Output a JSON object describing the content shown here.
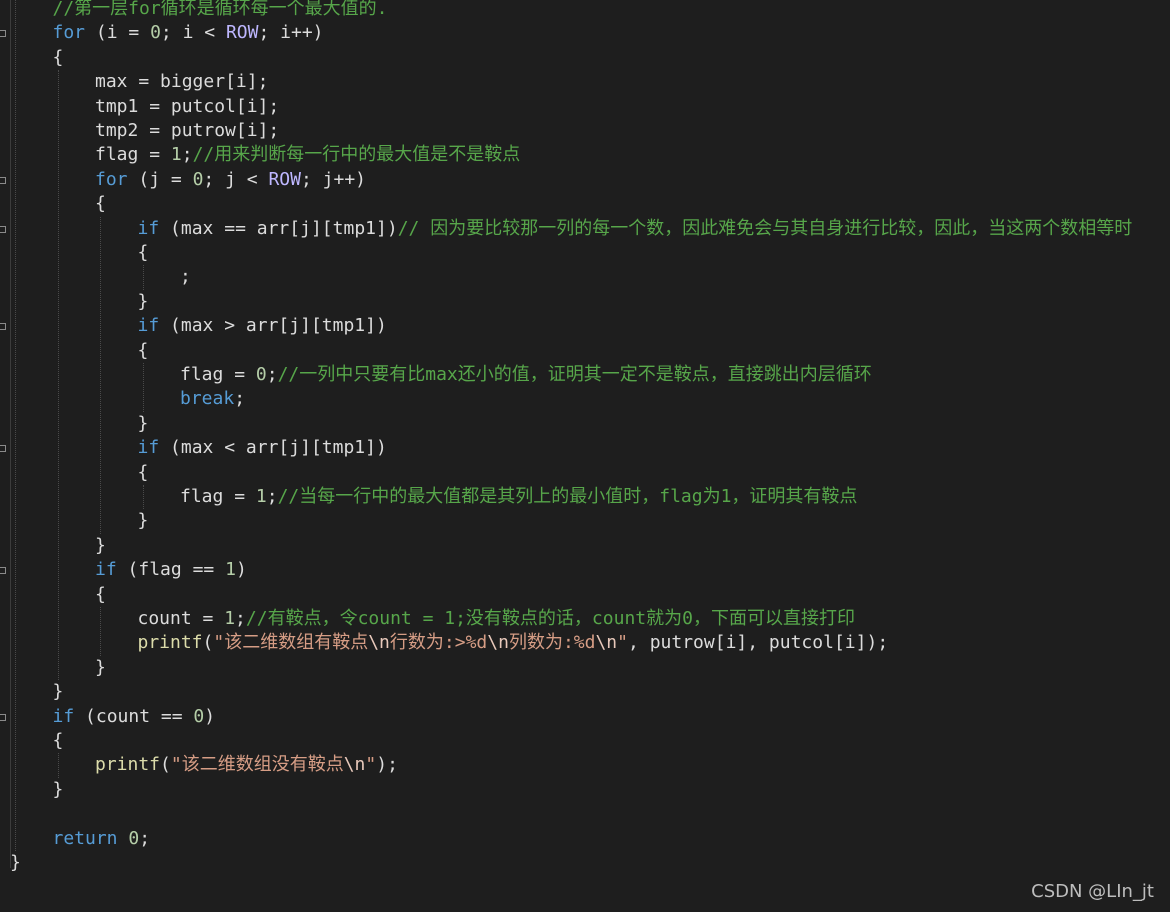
{
  "editor": {
    "watermark": "CSDN @LIn_jt",
    "colors": {
      "background": "#1e1e1e",
      "keyword": "#569cd6",
      "number": "#b5cea8",
      "comment": "#57a64a",
      "string": "#d69d85",
      "function": "#dcdcaa",
      "macro": "#beb7ff",
      "text": "#dcdcdc"
    },
    "lines": [
      {
        "indent": 1,
        "tokens": [
          [
            "cmt",
            "//第一层for循环是循环每一个最大值的."
          ]
        ]
      },
      {
        "indent": 1,
        "tokens": [
          [
            "kw",
            "for"
          ],
          [
            "pun",
            " ("
          ],
          [
            "var",
            "i"
          ],
          [
            "pun",
            " = "
          ],
          [
            "num",
            "0"
          ],
          [
            "pun",
            "; "
          ],
          [
            "var",
            "i"
          ],
          [
            "pun",
            " < "
          ],
          [
            "mac",
            "ROW"
          ],
          [
            "pun",
            "; "
          ],
          [
            "var",
            "i"
          ],
          [
            "pun",
            "++)"
          ]
        ]
      },
      {
        "indent": 1,
        "tokens": [
          [
            "pun",
            "{"
          ]
        ]
      },
      {
        "indent": 2,
        "tokens": [
          [
            "var",
            "max"
          ],
          [
            "pun",
            " = "
          ],
          [
            "var",
            "bigger"
          ],
          [
            "pun",
            "["
          ],
          [
            "var",
            "i"
          ],
          [
            "pun",
            "];"
          ]
        ]
      },
      {
        "indent": 2,
        "tokens": [
          [
            "var",
            "tmp1"
          ],
          [
            "pun",
            " = "
          ],
          [
            "var",
            "putcol"
          ],
          [
            "pun",
            "["
          ],
          [
            "var",
            "i"
          ],
          [
            "pun",
            "];"
          ]
        ]
      },
      {
        "indent": 2,
        "tokens": [
          [
            "var",
            "tmp2"
          ],
          [
            "pun",
            " = "
          ],
          [
            "var",
            "putrow"
          ],
          [
            "pun",
            "["
          ],
          [
            "var",
            "i"
          ],
          [
            "pun",
            "];"
          ]
        ]
      },
      {
        "indent": 2,
        "tokens": [
          [
            "var",
            "flag"
          ],
          [
            "pun",
            " = "
          ],
          [
            "num",
            "1"
          ],
          [
            "pun",
            ";"
          ],
          [
            "cmt",
            "//用来判断每一行中的最大值是不是鞍点"
          ]
        ]
      },
      {
        "indent": 2,
        "tokens": [
          [
            "kw",
            "for"
          ],
          [
            "pun",
            " ("
          ],
          [
            "var",
            "j"
          ],
          [
            "pun",
            " = "
          ],
          [
            "num",
            "0"
          ],
          [
            "pun",
            "; "
          ],
          [
            "var",
            "j"
          ],
          [
            "pun",
            " < "
          ],
          [
            "mac",
            "ROW"
          ],
          [
            "pun",
            "; "
          ],
          [
            "var",
            "j"
          ],
          [
            "pun",
            "++)"
          ]
        ]
      },
      {
        "indent": 2,
        "tokens": [
          [
            "pun",
            "{"
          ]
        ]
      },
      {
        "indent": 3,
        "tokens": [
          [
            "kw",
            "if"
          ],
          [
            "pun",
            " ("
          ],
          [
            "var",
            "max"
          ],
          [
            "pun",
            " == "
          ],
          [
            "var",
            "arr"
          ],
          [
            "pun",
            "["
          ],
          [
            "var",
            "j"
          ],
          [
            "pun",
            "]["
          ],
          [
            "var",
            "tmp1"
          ],
          [
            "pun",
            "])"
          ],
          [
            "cmt",
            "// 因为要比较那一列的每一个数，因此难免会与其自身进行比较，因此，当这两个数相等时"
          ]
        ]
      },
      {
        "indent": 3,
        "tokens": [
          [
            "pun",
            "{"
          ]
        ]
      },
      {
        "indent": 4,
        "tokens": [
          [
            "pun",
            ";"
          ]
        ]
      },
      {
        "indent": 3,
        "tokens": [
          [
            "pun",
            "}"
          ]
        ]
      },
      {
        "indent": 3,
        "tokens": [
          [
            "kw",
            "if"
          ],
          [
            "pun",
            " ("
          ],
          [
            "var",
            "max"
          ],
          [
            "pun",
            " > "
          ],
          [
            "var",
            "arr"
          ],
          [
            "pun",
            "["
          ],
          [
            "var",
            "j"
          ],
          [
            "pun",
            "]["
          ],
          [
            "var",
            "tmp1"
          ],
          [
            "pun",
            "])"
          ]
        ]
      },
      {
        "indent": 3,
        "tokens": [
          [
            "pun",
            "{"
          ]
        ]
      },
      {
        "indent": 4,
        "tokens": [
          [
            "var",
            "flag"
          ],
          [
            "pun",
            " = "
          ],
          [
            "num",
            "0"
          ],
          [
            "pun",
            ";"
          ],
          [
            "cmt",
            "//一列中只要有比max还小的值，证明其一定不是鞍点，直接跳出内层循环"
          ]
        ]
      },
      {
        "indent": 4,
        "tokens": [
          [
            "kw",
            "break"
          ],
          [
            "pun",
            ";"
          ]
        ]
      },
      {
        "indent": 3,
        "tokens": [
          [
            "pun",
            "}"
          ]
        ]
      },
      {
        "indent": 3,
        "tokens": [
          [
            "kw",
            "if"
          ],
          [
            "pun",
            " ("
          ],
          [
            "var",
            "max"
          ],
          [
            "pun",
            " < "
          ],
          [
            "var",
            "arr"
          ],
          [
            "pun",
            "["
          ],
          [
            "var",
            "j"
          ],
          [
            "pun",
            "]["
          ],
          [
            "var",
            "tmp1"
          ],
          [
            "pun",
            "])"
          ]
        ]
      },
      {
        "indent": 3,
        "tokens": [
          [
            "pun",
            "{"
          ]
        ]
      },
      {
        "indent": 4,
        "tokens": [
          [
            "var",
            "flag"
          ],
          [
            "pun",
            " = "
          ],
          [
            "num",
            "1"
          ],
          [
            "pun",
            ";"
          ],
          [
            "cmt",
            "//当每一行中的最大值都是其列上的最小值时，flag为1，证明其有鞍点"
          ]
        ]
      },
      {
        "indent": 3,
        "tokens": [
          [
            "pun",
            "}"
          ]
        ]
      },
      {
        "indent": 2,
        "tokens": [
          [
            "pun",
            "}"
          ]
        ]
      },
      {
        "indent": 2,
        "tokens": [
          [
            "kw",
            "if"
          ],
          [
            "pun",
            " ("
          ],
          [
            "var",
            "flag"
          ],
          [
            "pun",
            " == "
          ],
          [
            "num",
            "1"
          ],
          [
            "pun",
            ")"
          ]
        ]
      },
      {
        "indent": 2,
        "tokens": [
          [
            "pun",
            "{"
          ]
        ]
      },
      {
        "indent": 3,
        "tokens": [
          [
            "var",
            "count"
          ],
          [
            "pun",
            " = "
          ],
          [
            "num",
            "1"
          ],
          [
            "pun",
            ";"
          ],
          [
            "cmt",
            "//有鞍点，令count = 1;没有鞍点的话，count就为0，下面可以直接打印"
          ]
        ]
      },
      {
        "indent": 3,
        "tokens": [
          [
            "fn",
            "printf"
          ],
          [
            "pun",
            "("
          ],
          [
            "str",
            "\"该二维数组有鞍点"
          ],
          [
            "esc",
            "\\n"
          ],
          [
            "str",
            "行数为:>%d"
          ],
          [
            "esc",
            "\\n"
          ],
          [
            "str",
            "列数为:%d"
          ],
          [
            "esc",
            "\\n"
          ],
          [
            "str",
            "\""
          ],
          [
            "pun",
            ", "
          ],
          [
            "var",
            "putrow"
          ],
          [
            "pun",
            "["
          ],
          [
            "var",
            "i"
          ],
          [
            "pun",
            "], "
          ],
          [
            "var",
            "putcol"
          ],
          [
            "pun",
            "["
          ],
          [
            "var",
            "i"
          ],
          [
            "pun",
            "]);"
          ]
        ]
      },
      {
        "indent": 2,
        "tokens": [
          [
            "pun",
            "}"
          ]
        ]
      },
      {
        "indent": 1,
        "tokens": [
          [
            "pun",
            "}"
          ]
        ]
      },
      {
        "indent": 1,
        "tokens": [
          [
            "kw",
            "if"
          ],
          [
            "pun",
            " ("
          ],
          [
            "var",
            "count"
          ],
          [
            "pun",
            " == "
          ],
          [
            "num",
            "0"
          ],
          [
            "pun",
            ")"
          ]
        ]
      },
      {
        "indent": 1,
        "tokens": [
          [
            "pun",
            "{"
          ]
        ]
      },
      {
        "indent": 2,
        "tokens": [
          [
            "fn",
            "printf"
          ],
          [
            "pun",
            "("
          ],
          [
            "str",
            "\"该二维数组没有鞍点"
          ],
          [
            "esc",
            "\\n"
          ],
          [
            "str",
            "\""
          ],
          [
            "pun",
            ");"
          ]
        ]
      },
      {
        "indent": 1,
        "tokens": [
          [
            "pun",
            "}"
          ]
        ]
      },
      {
        "indent": 0,
        "tokens": []
      },
      {
        "indent": 1,
        "tokens": [
          [
            "kw",
            "return"
          ],
          [
            "pun",
            " "
          ],
          [
            "num",
            "0"
          ],
          [
            "pun",
            ";"
          ]
        ]
      },
      {
        "indent": 0,
        "tokens": [
          [
            "pun",
            "}"
          ]
        ]
      }
    ]
  }
}
